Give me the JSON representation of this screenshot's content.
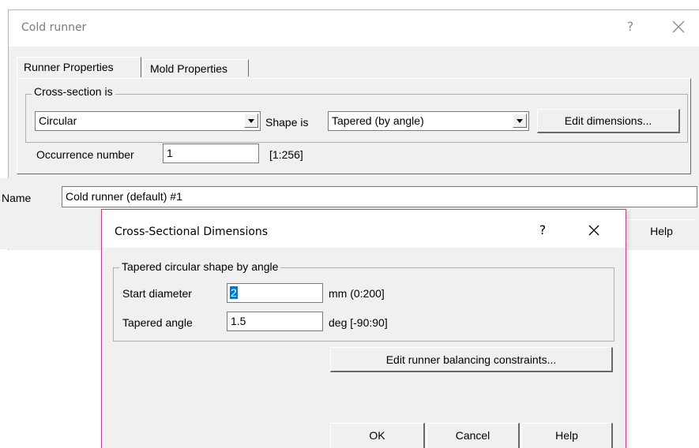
{
  "cold_runner": {
    "title": "Cold runner",
    "help_glyph": "?",
    "tabs": [
      {
        "label": "Runner Properties",
        "active": true
      },
      {
        "label": "Mold Properties",
        "active": false
      }
    ],
    "cross_section_group": {
      "label": "Cross-section is",
      "cross_section_value": "Circular",
      "shape_label": "Shape is",
      "shape_value": "Tapered (by angle)",
      "edit_dimensions_label": "Edit dimensions..."
    },
    "occurrence": {
      "label": "Occurrence number",
      "value": "1",
      "range": "[1:256]"
    },
    "name": {
      "label": "Name",
      "value": "Cold runner (default) #1"
    },
    "help_button_label": "Help"
  },
  "cross_sectional_dialog": {
    "title": "Cross-Sectional Dimensions",
    "help_glyph": "?",
    "group_label": "Tapered circular shape by angle",
    "start_diameter": {
      "label": "Start diameter",
      "value": "2",
      "unit": "mm (0:200]"
    },
    "tapered_angle": {
      "label": "Tapered angle",
      "value": "1.5",
      "unit": "deg [-90:90]"
    },
    "balancing_button_label": "Edit runner balancing constraints...",
    "ok_label": "OK",
    "cancel_label": "Cancel",
    "help_label": "Help"
  },
  "colors": {
    "dialog_accent": "#d2358c",
    "selection": "#0078d7",
    "window_bg": "#f0f0f0"
  }
}
